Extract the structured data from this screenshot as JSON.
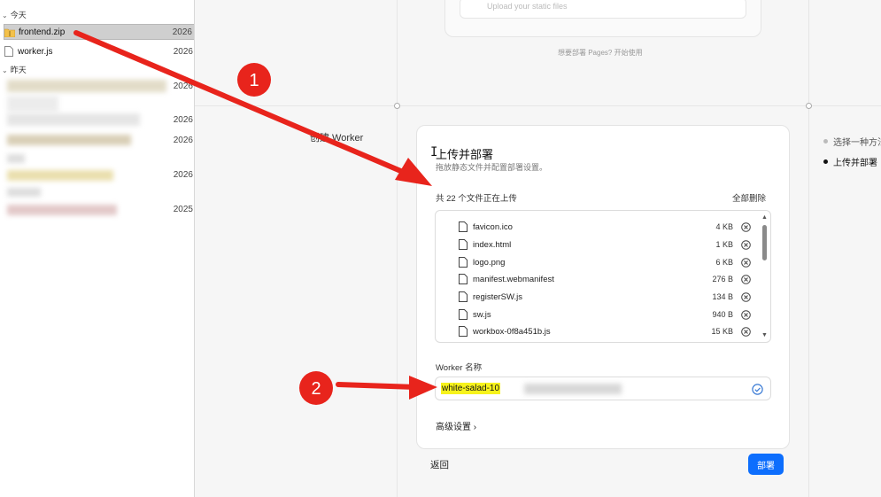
{
  "explorer": {
    "groups": {
      "today": "今天",
      "yesterday": "昨天"
    },
    "files": [
      {
        "name": "frontend.zip",
        "date": "2026",
        "selected": true,
        "icon": "zip-folder-icon"
      },
      {
        "name": "worker.js",
        "date": "2026",
        "selected": false,
        "icon": "file-icon"
      }
    ],
    "blurred_dates": [
      "2026",
      "2026",
      "2026",
      "2026",
      "2025"
    ]
  },
  "page": {
    "top_hint": "想要部署 Pages? 开始使用",
    "top_card_text": "Upload your static files",
    "side_label": "创建 Worker",
    "steps": [
      {
        "label": "选择一种方法",
        "active": false
      },
      {
        "label": "上传并部署",
        "active": true
      }
    ]
  },
  "dialog": {
    "title": "上传并部署",
    "subtitle": "拖放静态文件并配置部署设置。",
    "upload_count": "共 22 个文件正在上传",
    "remove_all": "全部删除",
    "files": [
      {
        "name": "favicon.ico",
        "size": "4 KB"
      },
      {
        "name": "index.html",
        "size": "1 KB"
      },
      {
        "name": "logo.png",
        "size": "6 KB"
      },
      {
        "name": "manifest.webmanifest",
        "size": "276 B"
      },
      {
        "name": "registerSW.js",
        "size": "134 B"
      },
      {
        "name": "sw.js",
        "size": "940 B"
      },
      {
        "name": "workbox-0f8a451b.js",
        "size": "15 KB"
      }
    ],
    "worker_name_label": "Worker 名称",
    "worker_name_value": "white-salad-10",
    "advanced": "高级设置 ›"
  },
  "footer": {
    "back": "返回",
    "deploy": "部署"
  },
  "annotations": {
    "badge1": "1",
    "badge2": "2"
  },
  "colors": {
    "accent": "#0d6efd",
    "annotation": "#e8241c",
    "highlight": "#f7f31c"
  }
}
